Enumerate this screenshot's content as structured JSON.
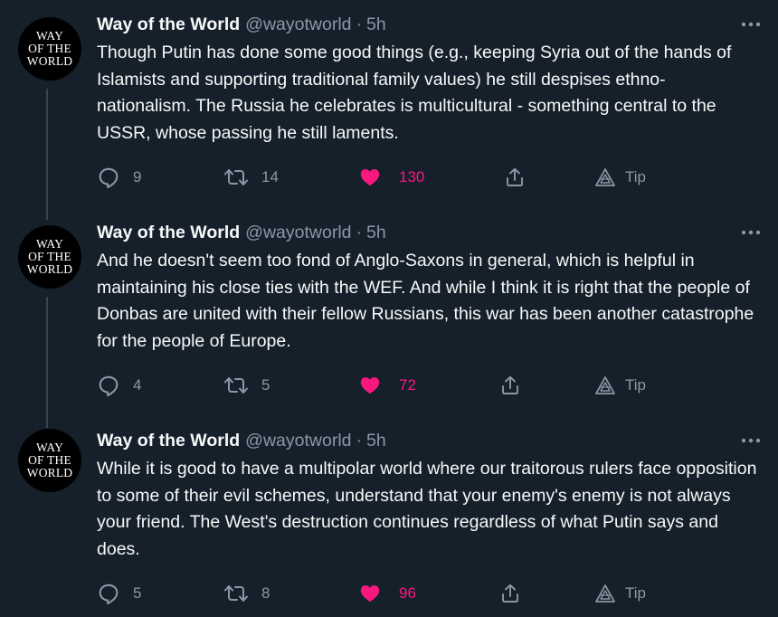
{
  "tweets": [
    {
      "author_name": "Way of the World",
      "handle": "@wayotworld",
      "separator": "·",
      "time": "5h",
      "avatar_lines": [
        "WAY",
        "OF THE",
        "WORLD"
      ],
      "text": "Though Putin has done some good things (e.g., keeping Syria out of the hands of Islamists and supporting traditional family values) he still despises ethno-nationalism. The Russia he celebrates is multicultural - something central to the USSR, whose passing he still laments.",
      "replies": "9",
      "retweets": "14",
      "likes": "130",
      "liked": true,
      "tip_label": "Tip"
    },
    {
      "author_name": "Way of the World",
      "handle": "@wayotworld",
      "separator": "·",
      "time": "5h",
      "avatar_lines": [
        "WAY",
        "OF THE",
        "WORLD"
      ],
      "text": "And he doesn't seem too fond of Anglo-Saxons in general, which is helpful in maintaining his close ties with the WEF. And while I think it is right that the people of Donbas are united with their fellow Russians, this war has been another catastrophe for the people of Europe.",
      "replies": "4",
      "retweets": "5",
      "likes": "72",
      "liked": true,
      "tip_label": "Tip"
    },
    {
      "author_name": "Way of the World",
      "handle": "@wayotworld",
      "separator": "·",
      "time": "5h",
      "avatar_lines": [
        "WAY",
        "OF THE",
        "WORLD"
      ],
      "text": "While it is good to have a multipolar world where our traitorous rulers face opposition to some of their evil schemes, understand that your enemy's enemy is not always your friend. The West's destruction continues regardless of what Putin says and does.",
      "replies": "5",
      "retweets": "8",
      "likes": "96",
      "liked": true,
      "tip_label": "Tip"
    }
  ],
  "colors": {
    "background": "#15202b",
    "text": "#f7f9f9",
    "muted": "#8b98a5",
    "like": "#f91880",
    "thread_line": "#38444d"
  },
  "icons": [
    "more-icon",
    "reply-icon",
    "retweet-icon",
    "heart-icon",
    "share-icon",
    "tip-icon"
  ]
}
